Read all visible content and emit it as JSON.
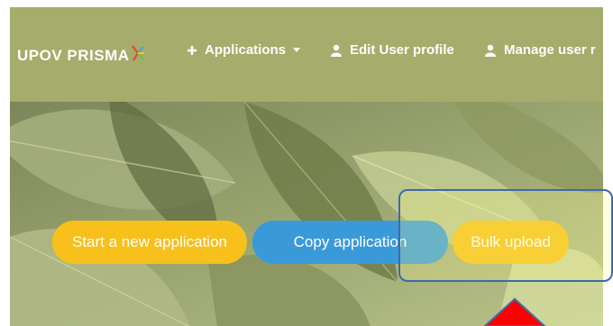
{
  "navbar": {
    "brand": "UPOV PRISMA",
    "items": [
      {
        "label": "Applications",
        "icon": "plus-icon",
        "has_dropdown": true
      },
      {
        "label": "Edit User profile",
        "icon": "user-icon"
      },
      {
        "label": "Manage user r",
        "icon": "user-icon"
      }
    ]
  },
  "actions": {
    "start_label": "Start a new application",
    "copy_label": "Copy application",
    "bulk_label": "Bulk upload"
  },
  "colors": {
    "navbar": "#a6ac6b",
    "yellow_button": "#f8c01a",
    "blue_button": "#3a9ad9",
    "highlight_border": "#3e6ba8",
    "arrow": "#ff0000"
  }
}
